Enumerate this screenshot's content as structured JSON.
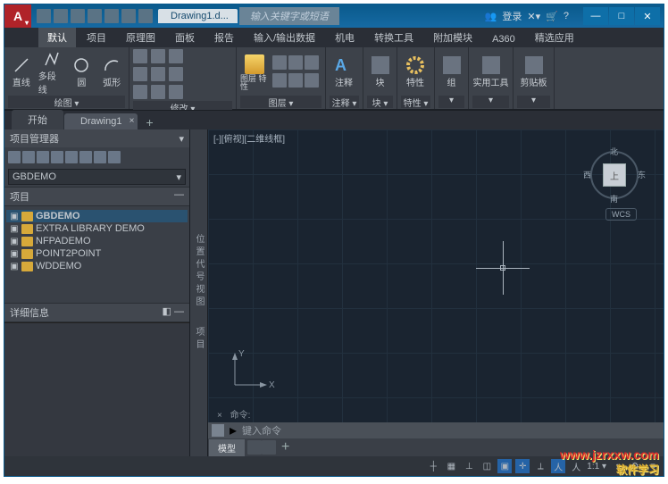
{
  "app": {
    "logo_letter": "A",
    "title_tab": "Drawing1.d...",
    "search_placeholder": "输入关键字或短语",
    "login_label": "登录"
  },
  "window_controls": {
    "min": "—",
    "max": "□",
    "close": "✕"
  },
  "ribbon_tabs": [
    "默认",
    "项目",
    "原理图",
    "面板",
    "报告",
    "输入/输出数据",
    "机电",
    "转换工具",
    "附加模块",
    "A360",
    "精选应用"
  ],
  "ribbon_tabs_active": 0,
  "ribbon": {
    "draw": {
      "title": "绘图 ▾",
      "line": "直线",
      "polyline": "多段线",
      "circle": "圆",
      "arc": "弧形"
    },
    "modify": {
      "title": "修改 ▾"
    },
    "layers": {
      "title": "图层 ▾",
      "btn": "图层\n特性"
    },
    "annotate": {
      "title": "注释 ▾",
      "btn": "注释"
    },
    "block": {
      "title": "块 ▾",
      "btn": "块"
    },
    "props": {
      "title": "特性 ▾",
      "btn": "特性"
    },
    "group": {
      "title": "▾",
      "btn": "组"
    },
    "utils": {
      "title": "▾",
      "btn": "实用工具"
    },
    "clip": {
      "title": "▾",
      "btn": "剪贴板"
    }
  },
  "doc_tabs": {
    "start": "开始",
    "current": "Drawing1",
    "plus": "+"
  },
  "project_panel": {
    "title": "项目管理器",
    "combo": "GBDEMO",
    "section_projects": "项目",
    "items": [
      {
        "label": "GBDEMO",
        "selected": true
      },
      {
        "label": "EXTRA LIBRARY DEMO",
        "selected": false
      },
      {
        "label": "NFPADEMO",
        "selected": false
      },
      {
        "label": "POINT2POINT",
        "selected": false
      },
      {
        "label": "WDDEMO",
        "selected": false
      }
    ],
    "section_details": "详细信息"
  },
  "vertical_label": "位置代号视图",
  "vertical_label2": "项目",
  "viewport": {
    "label": "[-][俯视][二维线框]",
    "cube": {
      "n": "北",
      "s": "南",
      "e": "东",
      "w": "西",
      "top": "上"
    },
    "wcs": "WCS",
    "ucs_x": "X",
    "ucs_y": "Y"
  },
  "command": {
    "history": "命令:",
    "icon_hint": "▸",
    "placeholder": "键入命令"
  },
  "model_tabs": {
    "model": "模型"
  },
  "status": {
    "scale": "1:1 ▾",
    "gear": "⚙",
    "items": [
      "┼",
      "▦",
      "⊥",
      "◫",
      "▣",
      "✛",
      "⟂",
      "人",
      "人",
      "↕"
    ]
  },
  "watermark": {
    "url": "www.jzrxxw.com",
    "sub": "软件学习"
  }
}
